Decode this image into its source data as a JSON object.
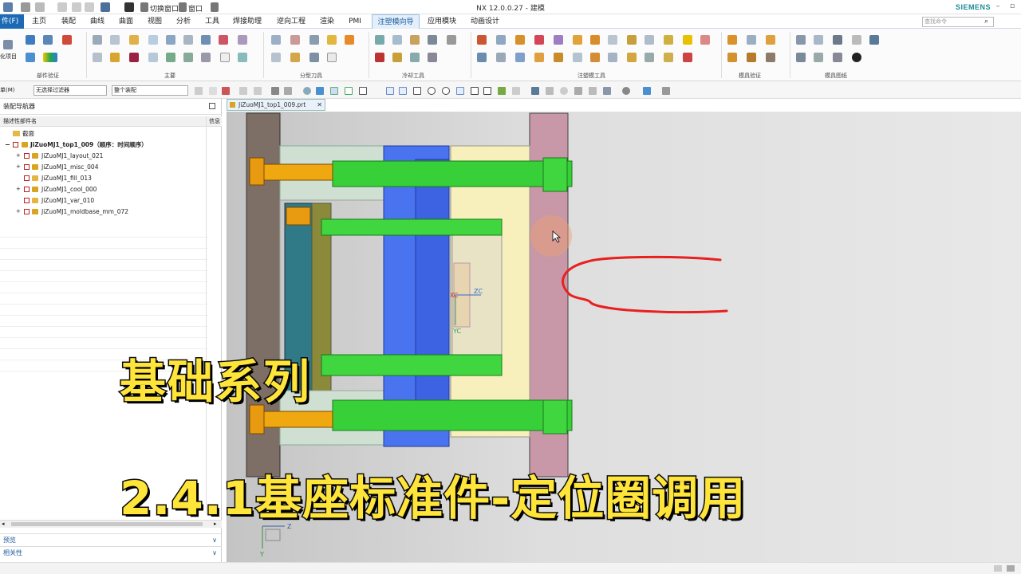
{
  "titlebar": {
    "switch_window": "切换窗口",
    "window_menu": "窗口",
    "title": "NX 12.0.0.27 - 建模",
    "brand": "SIEMENS"
  },
  "menu": {
    "file": "件(F)",
    "tabs": [
      "主页",
      "装配",
      "曲线",
      "曲面",
      "视图",
      "分析",
      "工具",
      "焊接助理",
      "逆向工程",
      "渲染",
      "PMI",
      "注塑模向导",
      "应用模块",
      "动画设计"
    ],
    "active_tab": "注塑模向导",
    "search_placeholder": "查找命令"
  },
  "ribbon": {
    "groups": [
      "部件验证",
      "主要",
      "分型刀具",
      "冷却工具",
      "注塑模工具",
      "模具验证",
      "模具图纸"
    ],
    "left_cut_label": "化项目"
  },
  "cmdbar": {
    "menu_cut": "单(M)",
    "filter": "无选择过滤器",
    "scope": "整个装配"
  },
  "navigator": {
    "title": "装配导航器",
    "col1": "描述性部件名",
    "col2": "信息",
    "section": "截面",
    "root": "JiZuoMJ1_top1_009（顺序：时间顺序）",
    "children": [
      "JiZuoMJ1_layout_021",
      "JiZuoMJ1_misc_004",
      "JiZuoMJ1_fill_013",
      "JiZuoMJ1_cool_000",
      "JiZuoMJ1_var_010",
      "JiZuoMJ1_moldbase_mm_072"
    ],
    "preview": "预览",
    "relevance": "相关性"
  },
  "viewport": {
    "tab_label": "JiZuoMJ1_top1_009.prt",
    "axis_labels": {
      "xc": "XC",
      "yc": "YC",
      "zc": "ZC"
    },
    "triad": {
      "z": "Z",
      "y": "Y"
    }
  },
  "captions": {
    "line1": "基础系列",
    "line2": "2.4.1基座标准件-定位圈调用"
  },
  "colors": {
    "file_tab": "#1c6ab5",
    "brand": "#1e8c95",
    "caption": "#ffe43a",
    "annotation": "#e82020"
  }
}
